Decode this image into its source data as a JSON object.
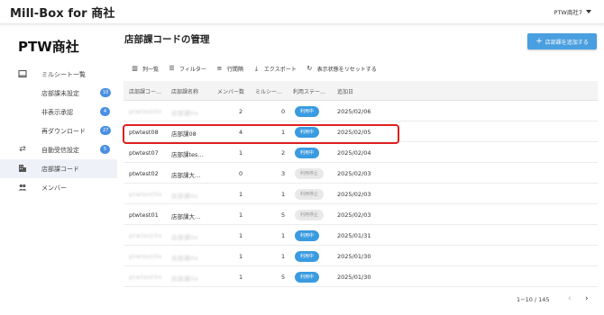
{
  "app": {
    "title": "Mill-Box for 商社",
    "account": "PTW商社7"
  },
  "sidebar": {
    "org_name": "PTW商社",
    "items": [
      {
        "label": "ミルシート一覧",
        "icon": "list-icon",
        "badge": ""
      },
      {
        "label": "店部課未設定",
        "icon": "",
        "badge": "10"
      },
      {
        "label": "非表示承認",
        "icon": "",
        "badge": "4"
      },
      {
        "label": "再ダウンロード",
        "icon": "",
        "badge": "27"
      },
      {
        "label": "自動受信設定",
        "icon": "transfer-icon",
        "badge": "5"
      },
      {
        "label": "店部課コード",
        "icon": "building-icon",
        "badge": ""
      },
      {
        "label": "メンバー",
        "icon": "people-icon",
        "badge": ""
      }
    ]
  },
  "page": {
    "title": "店部課コードの管理",
    "add_button": "店部課を追加する"
  },
  "toolbar": {
    "columns": "列一覧",
    "filter": "フィルター",
    "density": "行間隔",
    "export": "エクスポート",
    "reset": "表示状態をリセットする"
  },
  "table": {
    "headers": [
      "店部課コー…",
      "店部課名称",
      "メンバー数",
      "ミルシー…",
      "利用ステー…",
      "追加日"
    ],
    "rows": [
      {
        "code": "ptwtest0x",
        "name": "店部課0x",
        "members": "2",
        "mill": "0",
        "status": "利用中",
        "active": true,
        "date": "2025/02/06",
        "masked": true
      },
      {
        "code": "ptwtest08",
        "name": "店部課08",
        "members": "4",
        "mill": "1",
        "status": "利用中",
        "active": true,
        "date": "2025/02/05",
        "masked": false
      },
      {
        "code": "ptwtest07",
        "name": "店部課tes…",
        "members": "1",
        "mill": "2",
        "status": "利用中",
        "active": true,
        "date": "2025/02/04",
        "masked": false
      },
      {
        "code": "ptwtest02",
        "name": "店部課大…",
        "members": "0",
        "mill": "3",
        "status": "利用停止",
        "active": false,
        "date": "2025/02/03",
        "masked": false
      },
      {
        "code": "ptwtest0x",
        "name": "店部課0x",
        "members": "1",
        "mill": "1",
        "status": "利用停止",
        "active": false,
        "date": "2025/02/03",
        "masked": true
      },
      {
        "code": "ptwtest01",
        "name": "店部課大…",
        "members": "1",
        "mill": "5",
        "status": "利用停止",
        "active": false,
        "date": "2025/02/03",
        "masked": false
      },
      {
        "code": "ptwtest0x",
        "name": "店部課0x",
        "members": "1",
        "mill": "1",
        "status": "利用中",
        "active": true,
        "date": "2025/01/31",
        "masked": true
      },
      {
        "code": "ptwtest0x",
        "name": "店部課0x",
        "members": "1",
        "mill": "1",
        "status": "利用中",
        "active": true,
        "date": "2025/01/30",
        "masked": true
      },
      {
        "code": "ptwtest0x",
        "name": "店部課0x",
        "members": "1",
        "mill": "5",
        "status": "利用中",
        "active": true,
        "date": "2025/01/30",
        "masked": true
      }
    ]
  },
  "pagination": {
    "range": "1−10 / 145"
  },
  "colors": {
    "accent": "#4a9fe0",
    "highlight": "#e02020",
    "badge": "#4a90e2"
  }
}
